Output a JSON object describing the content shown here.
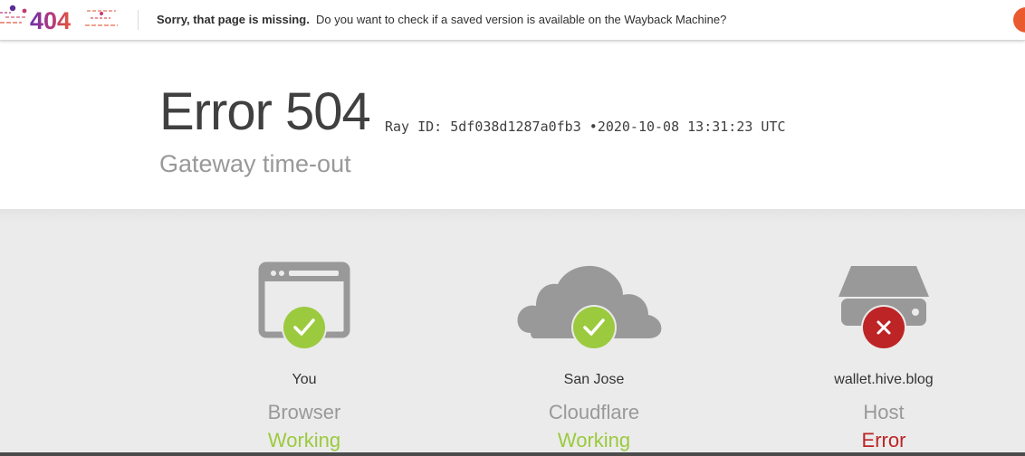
{
  "wayback": {
    "logo_text": "404",
    "message_strong": "Sorry, that page is missing.",
    "message": "Do you want to check if a saved version is available on the Wayback Machine?"
  },
  "error": {
    "title": "Error 504",
    "ray_label": "Ray ID:",
    "ray_id": "5df038d1287a0fb3",
    "bullet": "•",
    "timestamp": "2020-10-08 13:31:23 UTC",
    "subtitle": "Gateway time-out"
  },
  "cards": [
    {
      "location": "You",
      "name": "Browser",
      "status": "Working",
      "state": "ok",
      "icon": "browser-icon"
    },
    {
      "location": "San Jose",
      "name": "Cloudflare",
      "status": "Working",
      "state": "ok",
      "icon": "cloud-icon"
    },
    {
      "location": "wallet.hive.blog",
      "name": "Host",
      "status": "Error",
      "state": "error",
      "icon": "server-icon"
    }
  ],
  "colors": {
    "ok": "#9bca3e",
    "error": "#bd2426",
    "icon_gray": "#999999",
    "wayback_accent": "#ea5a2f"
  }
}
